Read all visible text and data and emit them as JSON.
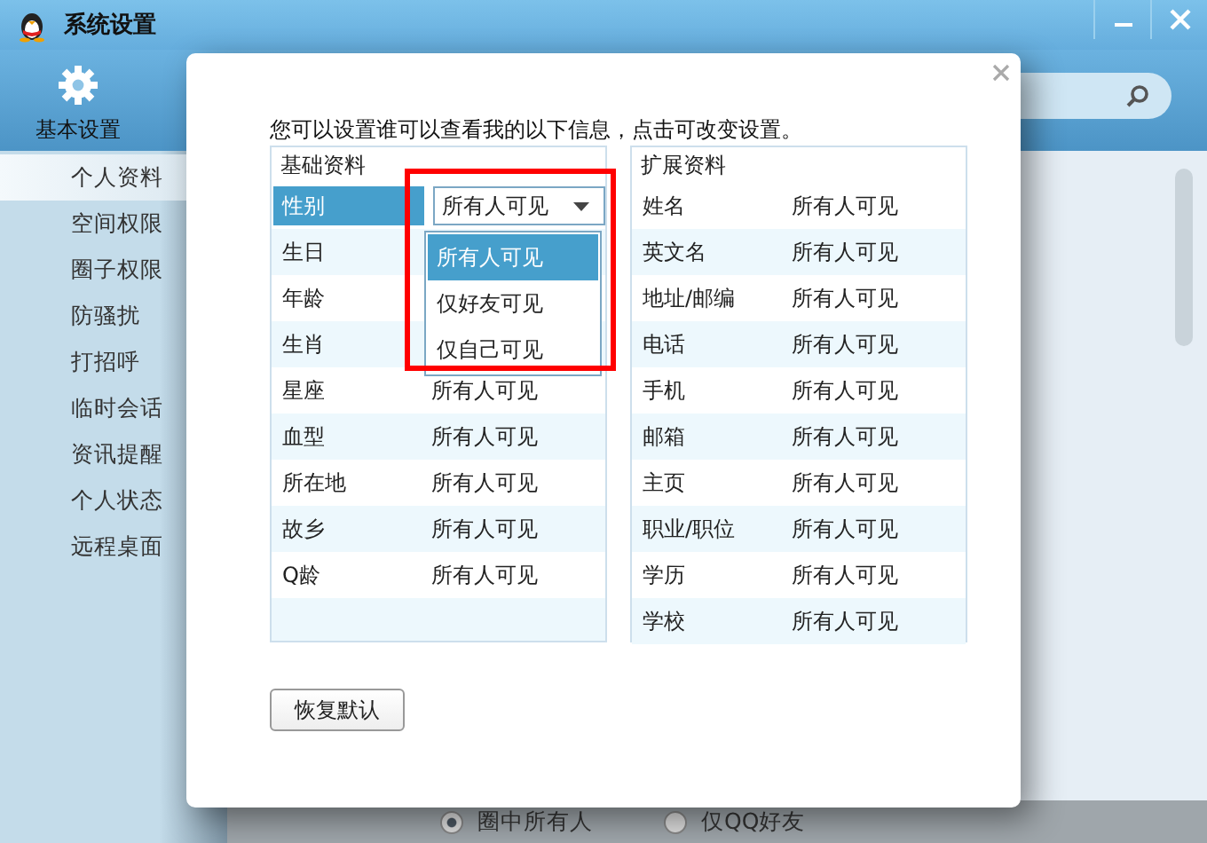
{
  "window": {
    "title": "系统设置"
  },
  "toolbar": {
    "label": "基本设置"
  },
  "sidebar": {
    "items": [
      {
        "label": "个人资料",
        "selected": true
      },
      {
        "label": "空间权限",
        "selected": false
      },
      {
        "label": "圈子权限",
        "selected": false
      },
      {
        "label": "防骚扰",
        "selected": false
      },
      {
        "label": "打招呼",
        "selected": false
      },
      {
        "label": "临时会话",
        "selected": false
      },
      {
        "label": "资讯提醒",
        "selected": false
      },
      {
        "label": "个人状态",
        "selected": false
      },
      {
        "label": "远程桌面",
        "selected": false
      }
    ]
  },
  "radios": [
    {
      "label": "圈中所有人",
      "selected": true
    },
    {
      "label": "仅QQ好友",
      "selected": false
    }
  ],
  "dialog": {
    "instruction": "您可以设置谁可以查看我的以下信息，点击可改变设置。",
    "basic": {
      "title": "基础资料",
      "rows": [
        {
          "label": "性别",
          "selected": true,
          "kind": "dropdown",
          "value": "所有人可见",
          "options": [
            {
              "label": "所有人可见",
              "selected": true
            },
            {
              "label": "仅好友可见",
              "selected": false
            },
            {
              "label": "仅自己可见",
              "selected": false
            }
          ]
        },
        {
          "label": "生日",
          "selected": false,
          "kind": "text"
        },
        {
          "label": "年龄",
          "selected": false,
          "kind": "text"
        },
        {
          "label": "生肖",
          "selected": false,
          "kind": "text"
        },
        {
          "label": "星座",
          "selected": false,
          "kind": "text",
          "value": "所有人可见"
        },
        {
          "label": "血型",
          "selected": false,
          "kind": "text",
          "value": "所有人可见"
        },
        {
          "label": "所在地",
          "selected": false,
          "kind": "text",
          "value": "所有人可见"
        },
        {
          "label": "故乡",
          "selected": false,
          "kind": "text",
          "value": "所有人可见"
        },
        {
          "label": "Q龄",
          "selected": false,
          "kind": "text",
          "value": "所有人可见"
        }
      ]
    },
    "extended": {
      "title": "扩展资料",
      "rows": [
        {
          "label": "姓名",
          "value": "所有人可见"
        },
        {
          "label": "英文名",
          "value": "所有人可见"
        },
        {
          "label": "地址/邮编",
          "value": "所有人可见"
        },
        {
          "label": "电话",
          "value": "所有人可见"
        },
        {
          "label": "手机",
          "value": "所有人可见"
        },
        {
          "label": "邮箱",
          "value": "所有人可见"
        },
        {
          "label": "主页",
          "value": "所有人可见"
        },
        {
          "label": "职业/职位",
          "value": "所有人可见"
        },
        {
          "label": "学历",
          "value": "所有人可见"
        },
        {
          "label": "学校",
          "value": "所有人可见"
        }
      ]
    },
    "reset_button": "恢复默认"
  }
}
